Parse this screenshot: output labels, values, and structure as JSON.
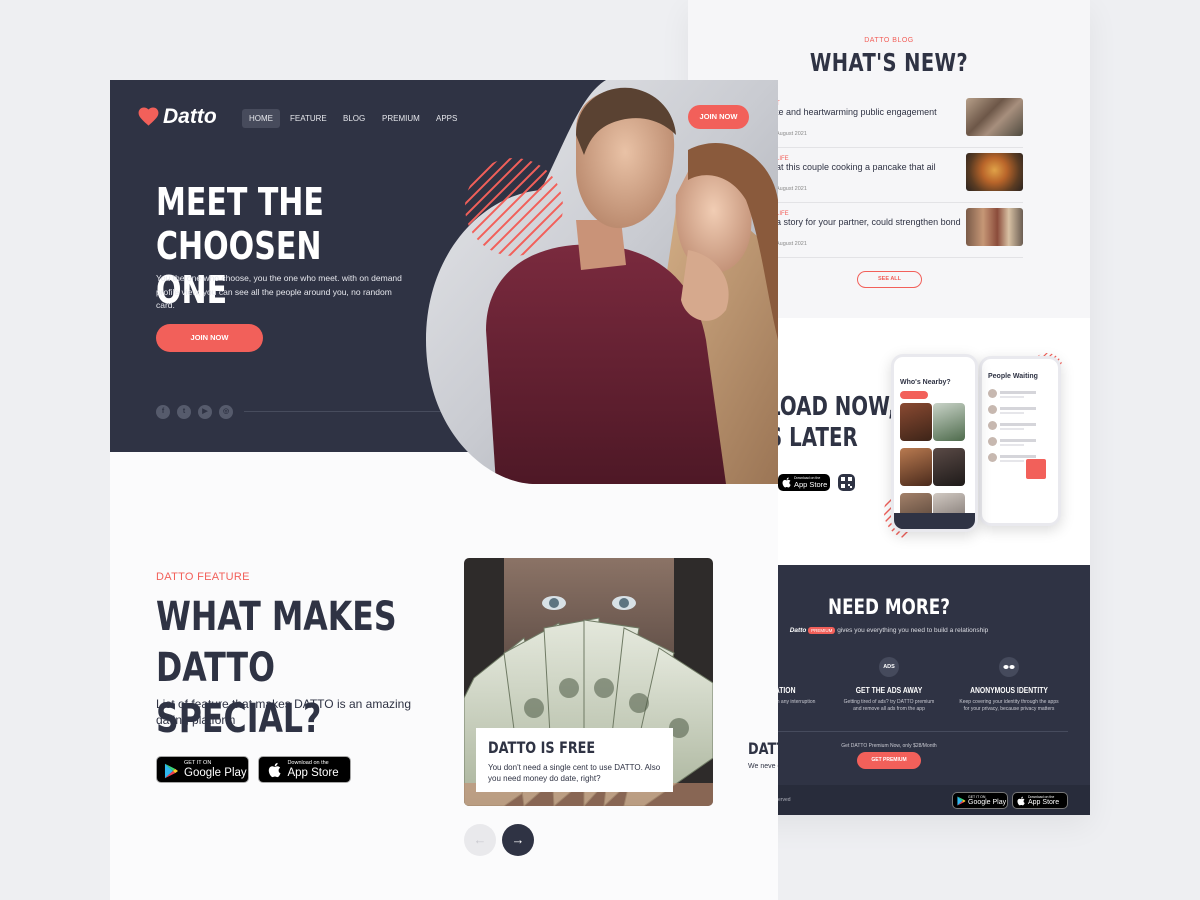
{
  "brand": {
    "name": "Datto",
    "accent": "#f2605a",
    "dark": "#2f3344"
  },
  "nav": {
    "items": [
      "HOME",
      "FEATURE",
      "BLOG",
      "PREMIUM",
      "APPS"
    ],
    "cta": "JOIN NOW"
  },
  "hero": {
    "title": "MEET THE CHOOSEN ONE",
    "text": "You the one who choose, you the one who meet. with on demand profile view, you can see all the people around you, no random card.",
    "cta": "JOIN NOW",
    "social": [
      "facebook-icon",
      "twitter-icon",
      "youtube-icon",
      "instagram-icon"
    ]
  },
  "feature": {
    "eyebrow": "DATTO FEATURE",
    "title": "WHAT MAKES DATTO SPECIAL?",
    "subtitle": "List of feature that makes DATTO is an amazing dating platform",
    "google_play": {
      "small": "GET IT ON",
      "big": "Google Play"
    },
    "app_store": {
      "small": "Download on the",
      "big": "App Store"
    },
    "cards": [
      {
        "title": "DATTO IS FREE",
        "text": "You don't need a single cent to use DATTO. Also you need money do date, right?"
      },
      {
        "title": "DATT",
        "text": "We neve organiza"
      }
    ]
  },
  "blog": {
    "eyebrow": "DATTO BLOG",
    "title": "WHAT'S NEW?",
    "posts": [
      {
        "category": "T",
        "title": "te and heartwarming public engagement",
        "date": "August 2021"
      },
      {
        "category": "LIFE",
        "title": "at this couple cooking a pancake that ail",
        "date": "August 2021"
      },
      {
        "category": "LIFE",
        "title": "a story for your partner, could strengthen bond",
        "date": "August 2021"
      }
    ],
    "see_all": "SEE ALL"
  },
  "download": {
    "title_1": "LOAD NOW,",
    "title_2": "S LATER",
    "phone_1_title": "Who's Nearby?",
    "phone_2_title": "People Waiting",
    "app_store_small": "Download on the",
    "app_store_big": "App Store"
  },
  "more": {
    "title": "NEED MORE?",
    "brand": "Datto",
    "badge": "PREMIUM",
    "subtitle": "gives you everything you need to build a relationship",
    "features": [
      {
        "icon": "",
        "title": "LORATION",
        "text": "of people through any interruption"
      },
      {
        "icon": "ADS",
        "title": "GET THE ADS AWAY",
        "text": "Getting tired of ads? try DATTO premium and remove all ads from the app"
      },
      {
        "icon": "",
        "title": "ANONYMOUS IDENTITY",
        "text": "Keep covering your identity through the apps for your privacy, because privacy matters"
      }
    ],
    "price": "Get DATTO Premium Now, only $28/Month",
    "cta": "GET PREMIUM",
    "copyright": "erved",
    "google_play": {
      "small": "GET IT ON",
      "big": "Google Play"
    },
    "app_store": {
      "small": "Download on the",
      "big": "App Store"
    }
  }
}
